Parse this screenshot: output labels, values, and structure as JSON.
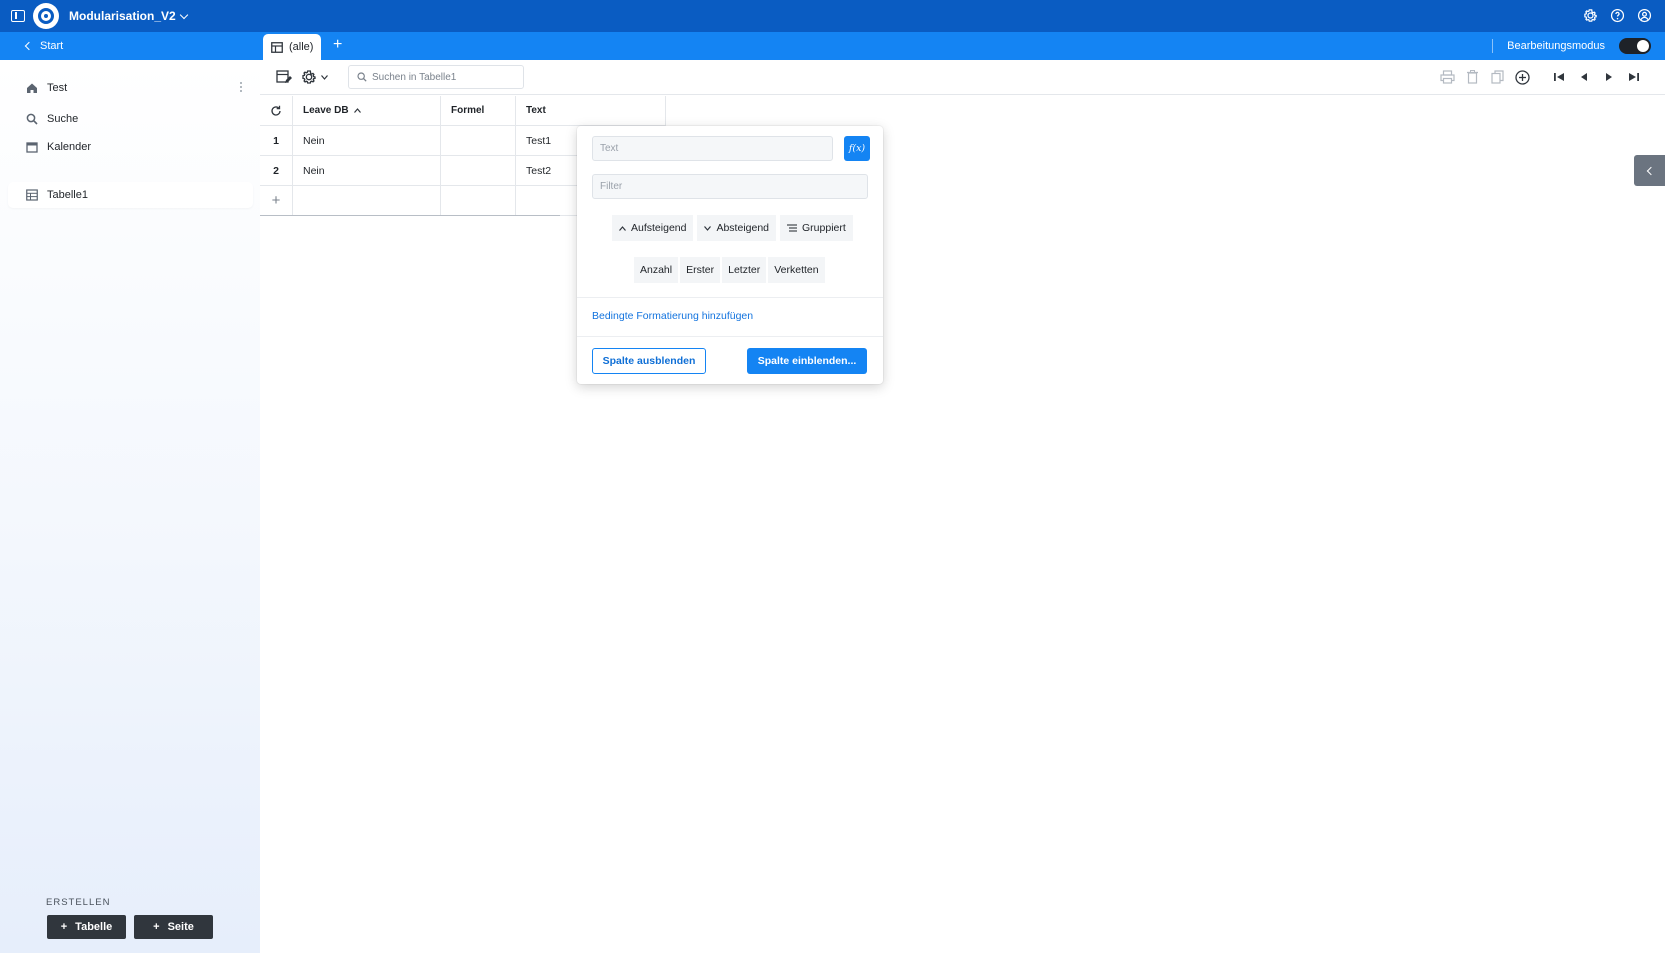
{
  "topbar": {
    "app_title": "Modularisation_V2",
    "icons": [
      "sidebar-toggle-icon",
      "app-logo",
      "settings-icon",
      "help-icon",
      "account-icon"
    ]
  },
  "subbar": {
    "back_label": "Start",
    "tab_label": "(alle)",
    "add_tab_label": "+",
    "edit_mode_label": "Bearbeitungsmodus",
    "edit_mode_on": true
  },
  "sidebar": {
    "items": [
      {
        "label": "Test",
        "icon": "home-icon"
      },
      {
        "label": "Suche",
        "icon": "search-icon"
      },
      {
        "label": "Kalender",
        "icon": "calendar-icon"
      },
      {
        "label": "Tabelle1",
        "icon": "table-icon",
        "selected": true
      }
    ],
    "create_label": "ERSTELLEN",
    "create_table_label": "Tabelle",
    "create_page_label": "Seite"
  },
  "toolbar": {
    "search_placeholder": "Suchen in Tabelle1"
  },
  "table": {
    "columns": [
      {
        "label": "Leave DB",
        "sorted": "asc"
      },
      {
        "label": "Formel"
      },
      {
        "label": "Text"
      }
    ],
    "rows": [
      {
        "index": "1",
        "cells": [
          "Nein",
          "",
          "Test1"
        ]
      },
      {
        "index": "2",
        "cells": [
          "Nein",
          "",
          "Test2"
        ]
      }
    ],
    "add_row_label": "+"
  },
  "column_popup": {
    "name_placeholder": "Text",
    "fx_label": "f(x)",
    "filter_placeholder": "Filter",
    "sort_asc_label": "Aufsteigend",
    "sort_desc_label": "Absteigend",
    "group_label": "Gruppiert",
    "agg_count_label": "Anzahl",
    "agg_first_label": "Erster",
    "agg_last_label": "Letzter",
    "agg_concat_label": "Verketten",
    "conditional_format_label": "Bedingte Formatierung hinzufügen",
    "hide_column_label": "Spalte ausblenden",
    "show_columns_label": "Spalte einblenden..."
  },
  "colors": {
    "topbar": "#0a5cc2",
    "subbar": "#1484f3",
    "accent": "#1484f3",
    "dark_button": "#30363d"
  }
}
